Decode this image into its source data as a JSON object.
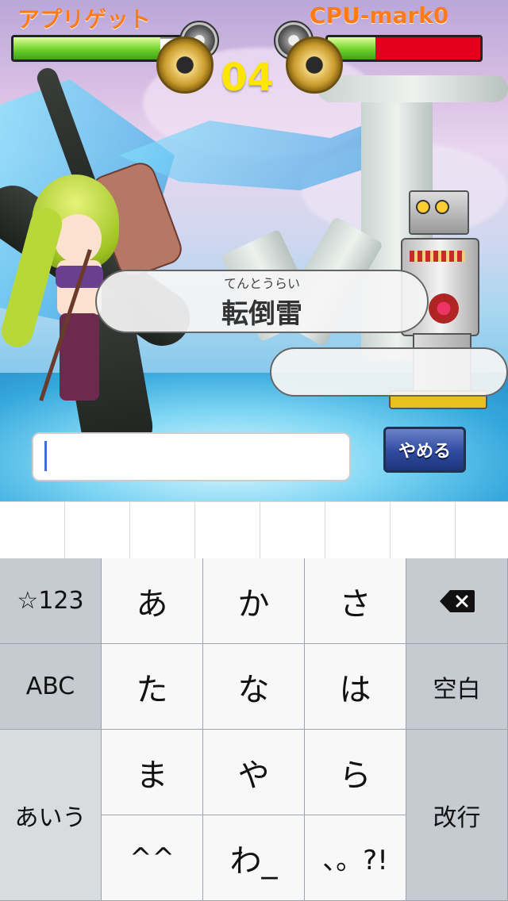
{
  "players": {
    "left_name": "アプリゲット",
    "right_name": "CPU-mark0",
    "left_hp_pct": 0.88,
    "right_hp_pct": 0.31
  },
  "timer": "04",
  "prompt": {
    "reading": "てんとうらい",
    "word": "転倒雷"
  },
  "input": {
    "value": ""
  },
  "buttons": {
    "quit": "やめる"
  },
  "keyboard": {
    "mode_key": "☆123",
    "abc_key": "ABC",
    "kana_mode_key": "あいう",
    "space_key": "空白",
    "enter_key": "改行",
    "keys": [
      "あ",
      "か",
      "さ",
      "た",
      "な",
      "は",
      "ま",
      "や",
      "ら",
      "^^",
      "わ_",
      "、。?!"
    ]
  },
  "colors": {
    "name_orange": "#ff7b1a",
    "timer_yellow": "#ffe600",
    "hp_green": "#6fd22a",
    "hp_red": "#e4001a",
    "caret_blue": "#3a6fdc",
    "quit_blue": "#2e4aa0"
  }
}
